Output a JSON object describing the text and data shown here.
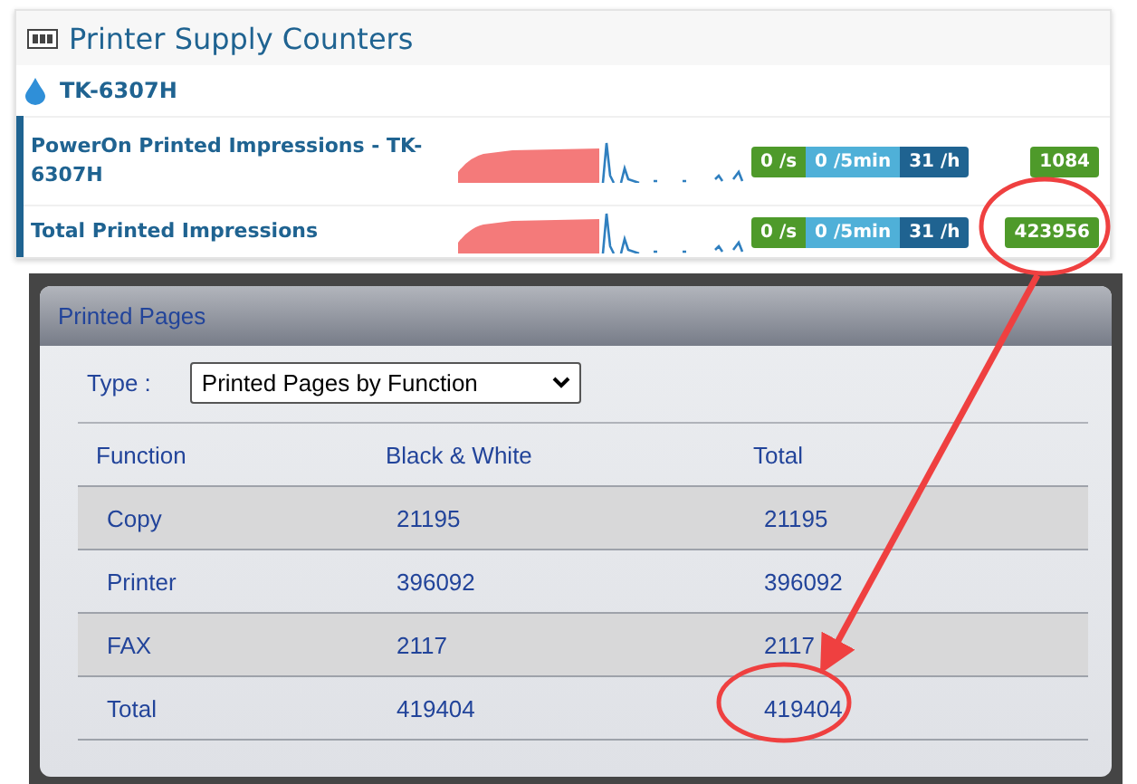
{
  "supply_panel": {
    "title": "Printer Supply Counters",
    "supply": "TK-6307H",
    "counters": [
      {
        "label": "PowerOn Printed Impressions - TK-6307H",
        "rates": [
          {
            "text": "0 /s",
            "color": "#4e9a2a"
          },
          {
            "text": "0 /5min",
            "color": "#4fb0d8"
          },
          {
            "text": "31 /h",
            "color": "#1f6391"
          }
        ],
        "count": "1084",
        "highlighted": false
      },
      {
        "label": "Total Printed Impressions",
        "rates": [
          {
            "text": "0 /s",
            "color": "#4e9a2a"
          },
          {
            "text": "0 /5min",
            "color": "#4fb0d8"
          },
          {
            "text": "31 /h",
            "color": "#1f6391"
          }
        ],
        "count": "423956",
        "highlighted": true
      }
    ]
  },
  "pages_panel": {
    "title": "Printed Pages",
    "type_label": "Type :",
    "type_value": "Printed Pages by Function",
    "table": {
      "columns": [
        "Function",
        "Black & White",
        "Total"
      ],
      "rows": [
        {
          "cells": [
            "Copy",
            "21195",
            "21195"
          ],
          "highlighted": false
        },
        {
          "cells": [
            "Printer",
            "396092",
            "396092"
          ],
          "highlighted": false
        },
        {
          "cells": [
            "FAX",
            "2117",
            "2117"
          ],
          "highlighted": false
        },
        {
          "cells": [
            "Total",
            "419404",
            "419404"
          ],
          "highlighted": true
        }
      ]
    }
  }
}
